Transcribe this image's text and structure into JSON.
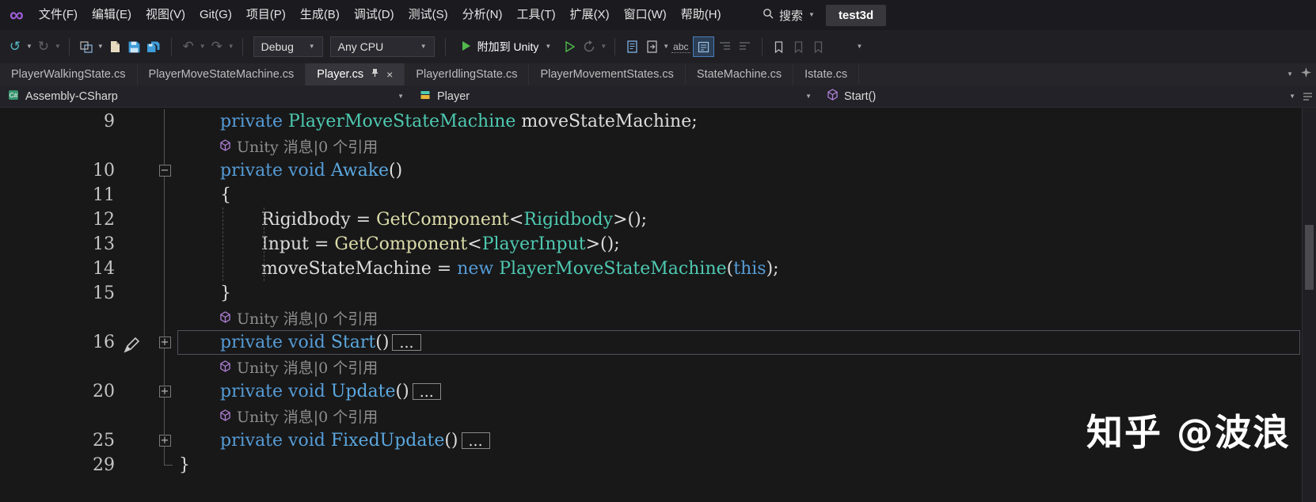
{
  "window": {
    "solution_name": "test3d",
    "search_label": "搜索"
  },
  "menu_bar": {
    "items": [
      "文件(F)",
      "编辑(E)",
      "视图(V)",
      "Git(G)",
      "项目(P)",
      "生成(B)",
      "调试(D)",
      "测试(S)",
      "分析(N)",
      "工具(T)",
      "扩展(X)",
      "窗口(W)",
      "帮助(H)"
    ]
  },
  "toolbar": {
    "configuration": "Debug",
    "platform": "Any CPU",
    "attach_label": "附加到 Unity",
    "abc_label": "abc"
  },
  "tabs": [
    {
      "label": "PlayerWalkingState.cs",
      "active": false
    },
    {
      "label": "PlayerMoveStateMachine.cs",
      "active": false
    },
    {
      "label": "Player.cs",
      "active": true
    },
    {
      "label": "PlayerIdlingState.cs",
      "active": false
    },
    {
      "label": "PlayerMovementStates.cs",
      "active": false
    },
    {
      "label": "StateMachine.cs",
      "active": false
    },
    {
      "label": "Istate.cs",
      "active": false
    }
  ],
  "navigation_bar": {
    "project": "Assembly-CSharp",
    "type": "Player",
    "member": "Start()"
  },
  "editor": {
    "codelens_text": "Unity 消息|0 个引用",
    "rows": [
      {
        "kind": "code",
        "num": "9",
        "margin": "line",
        "indent": 1,
        "tokens": [
          {
            "t": "private ",
            "c": "kw"
          },
          {
            "t": "PlayerMoveStateMachine",
            "c": "ty"
          },
          {
            "t": " moveStateMachine;",
            "c": "pl"
          }
        ]
      },
      {
        "kind": "codelens",
        "margin": "line",
        "indent": 1
      },
      {
        "kind": "code",
        "num": "10",
        "margin": "minus",
        "indent": 1,
        "tokens": [
          {
            "t": "private ",
            "c": "kw"
          },
          {
            "t": "void ",
            "c": "kw"
          },
          {
            "t": "Awake",
            "c": "md"
          },
          {
            "t": "()",
            "c": "pl"
          }
        ]
      },
      {
        "kind": "code",
        "num": "11",
        "margin": "line",
        "indent": 1,
        "tokens": [
          {
            "t": "{",
            "c": "pl"
          }
        ]
      },
      {
        "kind": "code",
        "num": "12",
        "margin": "line",
        "indent": 2,
        "tokens": [
          {
            "t": "Rigidbody = ",
            "c": "pl"
          },
          {
            "t": "GetComponent",
            "c": "mc"
          },
          {
            "t": "<",
            "c": "pl"
          },
          {
            "t": "Rigidbody",
            "c": "ty"
          },
          {
            "t": ">();",
            "c": "pl"
          }
        ]
      },
      {
        "kind": "code",
        "num": "13",
        "margin": "line",
        "indent": 2,
        "tokens": [
          {
            "t": "Input = ",
            "c": "pl"
          },
          {
            "t": "GetComponent",
            "c": "mc"
          },
          {
            "t": "<",
            "c": "pl"
          },
          {
            "t": "PlayerInput",
            "c": "ty"
          },
          {
            "t": ">();",
            "c": "pl"
          }
        ]
      },
      {
        "kind": "code",
        "num": "14",
        "margin": "line",
        "indent": 2,
        "tokens": [
          {
            "t": "moveStateMachine = ",
            "c": "pl"
          },
          {
            "t": "new ",
            "c": "kw"
          },
          {
            "t": "PlayerMoveStateMachine",
            "c": "ty"
          },
          {
            "t": "(",
            "c": "pl"
          },
          {
            "t": "this",
            "c": "kw"
          },
          {
            "t": ");",
            "c": "pl"
          }
        ]
      },
      {
        "kind": "code",
        "num": "15",
        "margin": "line",
        "indent": 1,
        "tokens": [
          {
            "t": "}",
            "c": "pl"
          }
        ]
      },
      {
        "kind": "codelens",
        "margin": "line",
        "indent": 1
      },
      {
        "kind": "code",
        "num": "16",
        "margin": "plus",
        "indent": 1,
        "current": true,
        "pen": true,
        "collapsed": true,
        "tokens": [
          {
            "t": "private ",
            "c": "kw"
          },
          {
            "t": "void ",
            "c": "kw"
          },
          {
            "t": "Start",
            "c": "md"
          },
          {
            "t": "()",
            "c": "pl"
          }
        ]
      },
      {
        "kind": "codelens",
        "margin": "line",
        "indent": 1
      },
      {
        "kind": "code",
        "num": "20",
        "margin": "plus",
        "indent": 1,
        "collapsed": true,
        "tokens": [
          {
            "t": "private ",
            "c": "kw"
          },
          {
            "t": "void ",
            "c": "kw"
          },
          {
            "t": "Update",
            "c": "md"
          },
          {
            "t": "()",
            "c": "pl"
          }
        ]
      },
      {
        "kind": "codelens",
        "margin": "line",
        "indent": 1
      },
      {
        "kind": "code",
        "num": "25",
        "margin": "plus",
        "indent": 1,
        "collapsed": true,
        "tokens": [
          {
            "t": "private ",
            "c": "kw"
          },
          {
            "t": "void ",
            "c": "kw"
          },
          {
            "t": "FixedUpdate",
            "c": "md"
          },
          {
            "t": "()",
            "c": "pl"
          }
        ]
      },
      {
        "kind": "code",
        "num": "29",
        "margin": "corner",
        "indent": 0,
        "tokens": [
          {
            "t": "}",
            "c": "pl"
          }
        ]
      }
    ]
  },
  "watermark": "知乎 @波浪",
  "icons": {
    "infinity_logo": "∞",
    "caret": "▼",
    "close": "×",
    "back": "↺",
    "forward": "↻",
    "undo": "↶",
    "redo": "↷",
    "fold_open": "−",
    "fold_closed": "+",
    "ellipsis": "..."
  },
  "colors": {
    "keyword": "#569CD6",
    "type": "#4EC9B0",
    "method_call": "#DCDCAA",
    "method_decl": "#5BA7DE",
    "plain": "#DCDCDC",
    "codelens": "#8F8F8F",
    "unity_cube": "#B180D7",
    "attach_green": "#52B84D",
    "editor_bg": "#181819"
  }
}
